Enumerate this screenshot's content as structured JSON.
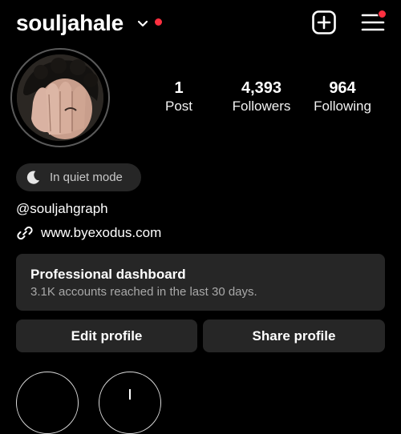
{
  "header": {
    "username": "souljahale",
    "icons": {
      "dropdown": "chevron-down-icon",
      "create": "plus-square-icon",
      "menu": "hamburger-menu-icon"
    },
    "notification_color": "#ff3040"
  },
  "stats": [
    {
      "value": "1",
      "label": "Post"
    },
    {
      "value": "4,393",
      "label": "Followers"
    },
    {
      "value": "964",
      "label": "Following"
    }
  ],
  "quiet_mode": {
    "label": "In quiet mode",
    "icon": "moon-icon"
  },
  "bio": {
    "handle": "@souljahgraph",
    "link": "www.byexodus.com",
    "link_icon": "link-icon"
  },
  "dashboard": {
    "title": "Professional dashboard",
    "subtitle": "3.1K accounts reached in the last 30 days."
  },
  "actions": {
    "edit_label": "Edit profile",
    "share_label": "Share profile"
  },
  "colors": {
    "background": "#000000",
    "surface": "#262626",
    "secondary_text": "#a8a8a8"
  }
}
